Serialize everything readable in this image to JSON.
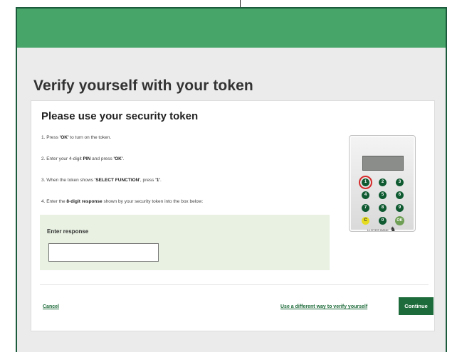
{
  "page": {
    "title": "Verify yourself with your token"
  },
  "card": {
    "title": "Please use your security token",
    "steps": [
      {
        "pre": "1. Press ",
        "bold": "'OK'",
        "post": " to turn on the token."
      },
      {
        "pre": "2. Enter your 4-digit ",
        "bold": "PIN",
        "mid": " and press ",
        "bold2": "'OK'",
        "post": "."
      },
      {
        "pre": "3. When the token shows ",
        "bold": "'SELECT FUNCTION'",
        "mid": ", press ",
        "bold2": "'1'",
        "post": "."
      },
      {
        "pre": "4. Enter the ",
        "bold": "8-digit response",
        "post": " shown by your security token into the box below:"
      }
    ],
    "response": {
      "label": "Enter response",
      "value": "",
      "placeholder": ""
    }
  },
  "actions": {
    "cancel": "Cancel",
    "alternative": "Use a different way to verify yourself",
    "continue": "Continue"
  },
  "token": {
    "keys": [
      "1",
      "2",
      "3",
      "4",
      "5",
      "6",
      "7",
      "8",
      "9",
      "C",
      "0",
      "OK"
    ],
    "brand_text": "LLOYDS BANK",
    "highlighted_key": "1"
  },
  "colors": {
    "header": "#48a56a",
    "primary": "#1d6b3a",
    "highlight_ring": "#d52b2b",
    "response_panel": "#e8f1e2"
  }
}
